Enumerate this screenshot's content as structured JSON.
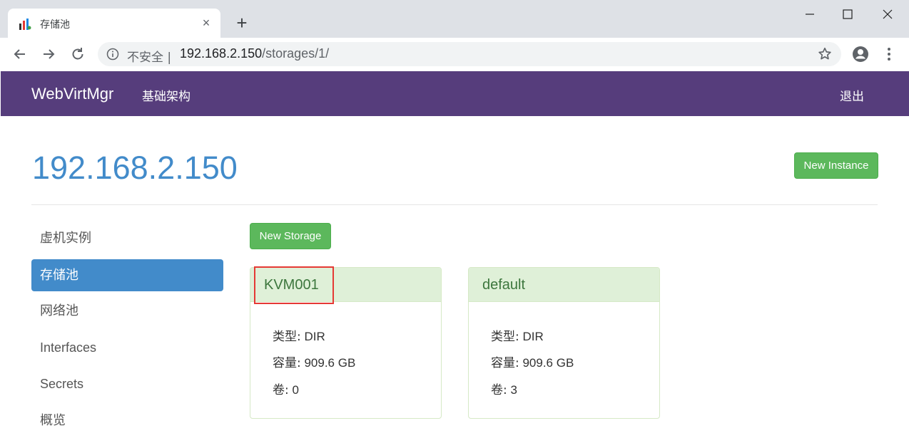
{
  "browser": {
    "tab_title": "存储池",
    "tab_close": "×",
    "new_tab": "+",
    "security_label": "不安全 |",
    "url_host": "192.168.2.150",
    "url_path": "/storages/1/"
  },
  "navbar": {
    "brand": "WebVirtMgr",
    "infrastructure": "基础架构",
    "logout": "退出",
    "color": "#563d7c"
  },
  "page": {
    "title": "192.168.2.150",
    "new_instance": "New Instance",
    "new_storage": "New Storage"
  },
  "sidebar": {
    "items": [
      {
        "label": "虚机实例",
        "active": false
      },
      {
        "label": "存储池",
        "active": true
      },
      {
        "label": "网络池",
        "active": false
      },
      {
        "label": "Interfaces",
        "active": false
      },
      {
        "label": "Secrets",
        "active": false
      },
      {
        "label": "概览",
        "active": false
      }
    ]
  },
  "storages": [
    {
      "name": "KVM001",
      "type_label": "类型:",
      "type": "DIR",
      "size_label": "容量:",
      "size": "909.6 GB",
      "volumes_label": "卷:",
      "volumes": "0"
    },
    {
      "name": "default",
      "type_label": "类型:",
      "type": "DIR",
      "size_label": "容量:",
      "size": "909.6 GB",
      "volumes_label": "卷:",
      "volumes": "3"
    }
  ]
}
